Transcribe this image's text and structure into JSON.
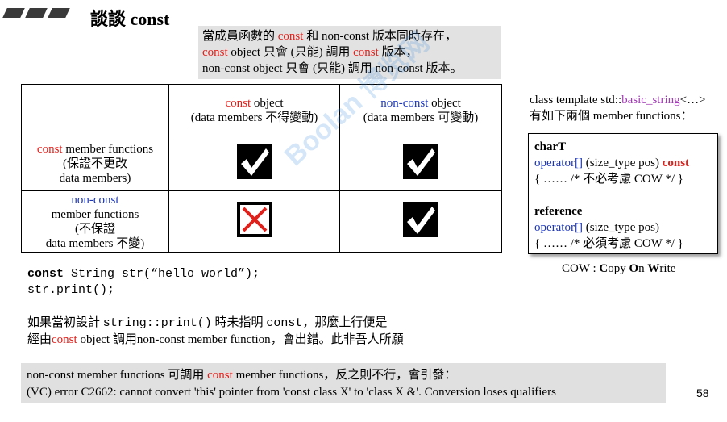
{
  "title": "談談 const",
  "top_note": {
    "line1": [
      "當成員函數的 ",
      "const",
      " 和 non-const 版本同時存在，"
    ],
    "line2": [
      "const",
      " object 只會 (只能) 調用 ",
      "const",
      " 版本，"
    ],
    "line3": "non-const object 只會 (只能) 調用 non-const 版本。"
  },
  "table": {
    "col1_head": [
      "const",
      " object",
      "(data members 不得變動)"
    ],
    "col2_head": [
      "non-const",
      " object",
      "(data members 可變動)"
    ],
    "row1_label": [
      "const",
      " member functions",
      "(保證不更改",
      "data members)"
    ],
    "row2_label": [
      "non-const",
      "member functions",
      "(不保證",
      "data members 不變)"
    ],
    "cells": {
      "r1c1": "check",
      "r1c2": "check",
      "r2c1": "cross",
      "r2c2": "check"
    }
  },
  "right_note": {
    "line1": [
      "class template std::",
      "basic_string",
      "<…>"
    ],
    "line2": "有如下兩個 member functions："
  },
  "code_box": {
    "block1_title": "charT",
    "block1_sig": [
      "operator[]",
      " (size_type pos) ",
      "const"
    ],
    "block1_body": "{  …… /* 不必考慮 COW */  }",
    "block2_title": "reference",
    "block2_sig": [
      "operator[]",
      " (size_type pos)"
    ],
    "block2_body": "{ …… /* 必須考慮 COW */  }"
  },
  "cow_note": [
    "COW : ",
    "C",
    "opy ",
    "O",
    "n ",
    "W",
    "rite"
  ],
  "code_lines": {
    "line1_kw": "const",
    "line1_rest": " String str(“hello world”);",
    "line2": "str.print();"
  },
  "paragraph": {
    "line1_a": "如果當初設計 ",
    "line1_code1": "string::print()",
    "line1_b": " 時未指明 ",
    "line1_code2": "const",
    "line1_c": "，那麼上行便是",
    "line2": [
      "經由",
      "const",
      " object 調用non-const member function，會出錯。此非吾人所願"
    ]
  },
  "bottom_note": {
    "line1": [
      "non-const member functions 可調用 ",
      "const",
      " member functions，反之則不行，會引發："
    ],
    "line2": "(VC) error C2662: cannot convert 'this' pointer from 'const class X' to 'class X &'.  Conversion loses qualifiers"
  },
  "page_number": "58",
  "watermark": "Boolan 博览网",
  "colors": {
    "accent_red": "#e0201b",
    "accent_blue": "#1c36b8",
    "accent_purple": "#a23bb5"
  }
}
